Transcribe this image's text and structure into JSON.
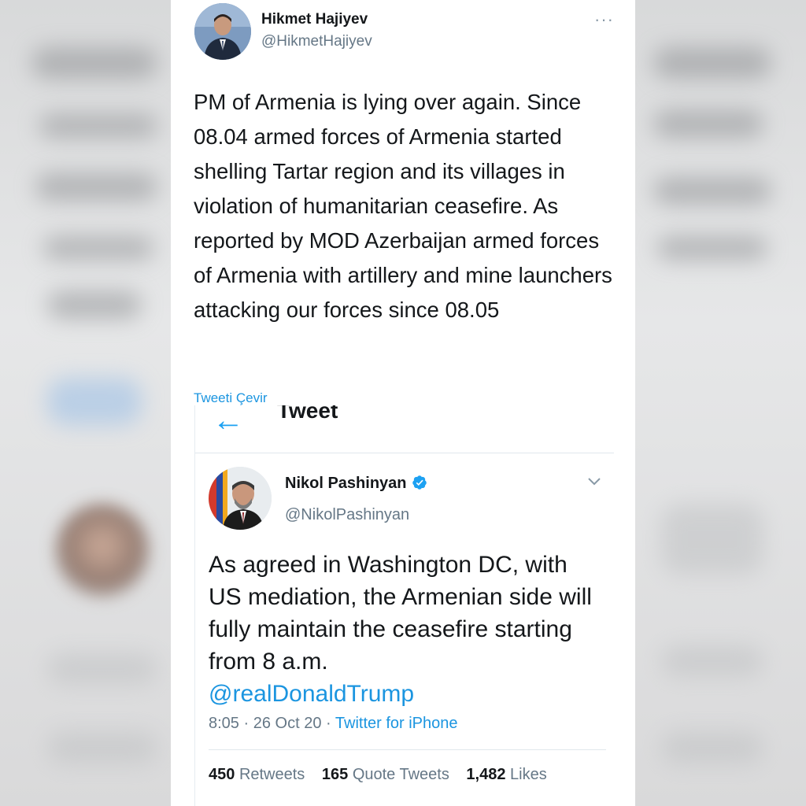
{
  "tweet": {
    "author_name": "Hikmet Hajiyev",
    "author_handle": "@HikmetHajiyev",
    "more_icon": "···",
    "text": "PM of Armenia is lying over again. Since 08.04 armed forces of Armenia started shelling Tartar region and its villages in violation of humanitarian ceasefire. As reported by MOD Azerbaijan armed forces of Armenia with artillery and mine launchers attacking our forces since 08.05",
    "translate_label": "Tweeti Çevir"
  },
  "embedded": {
    "header_title": "Tweet",
    "back_icon": "←",
    "author_name": "Nikol Pashinyan",
    "author_handle": "@NikolPashinyan",
    "text": "As agreed in Washington DC, with US mediation, the Armenian side will fully maintain the ceasefire starting from 8 a.m.",
    "mention": "@realDonaldTrump",
    "time": "8:05",
    "date": "26 Oct 20",
    "separator": "·",
    "source": "Twitter for iPhone",
    "stats": {
      "retweets_count": "450",
      "retweets_label": "Retweets",
      "quotes_count": "165",
      "quotes_label": "Quote Tweets",
      "likes_count": "1,482",
      "likes_label": "Likes"
    }
  },
  "colors": {
    "link_blue": "#1b95e0",
    "secondary_gray": "#657786",
    "text_dark": "#14171a"
  }
}
